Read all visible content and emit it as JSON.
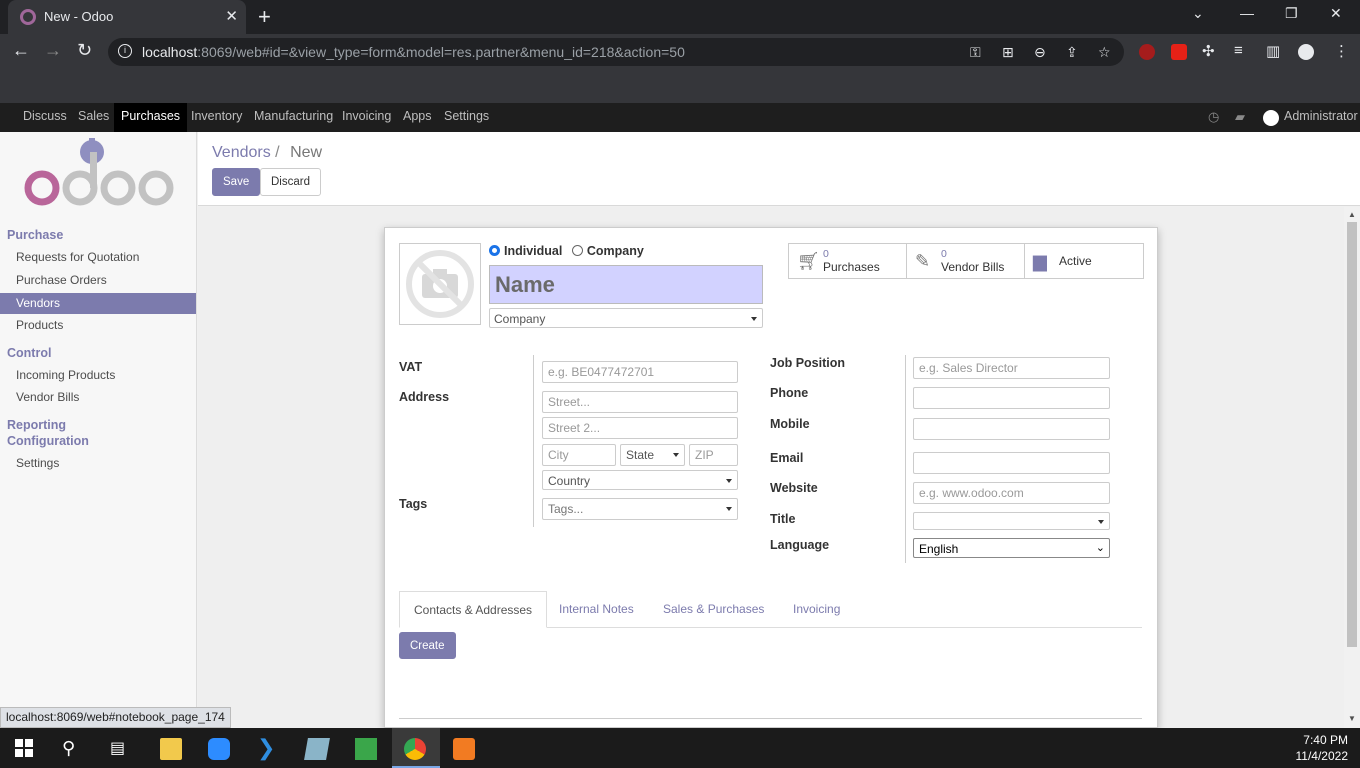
{
  "browser": {
    "tab_title": "New - Odoo",
    "url_host": "localhost",
    "url_rest": ":8069/web#id=&view_type=form&model=res.partner&menu_id=218&action=50",
    "status_url": "localhost:8069/web#notebook_page_174"
  },
  "topmenu": {
    "items": [
      "Discuss",
      "Sales",
      "Purchases",
      "Inventory",
      "Manufacturing",
      "Invoicing",
      "Apps",
      "Settings"
    ],
    "active": "Purchases",
    "user": "Administrator"
  },
  "sidebar": {
    "purchase_head": "Purchase",
    "purchase_items": [
      "Requests for Quotation",
      "Purchase Orders",
      "Vendors",
      "Products"
    ],
    "control_head": "Control",
    "control_items": [
      "Incoming Products",
      "Vendor Bills"
    ],
    "reporting_head": "Reporting",
    "config_head": "Configuration",
    "config_items": [
      "Settings"
    ],
    "active_item": "Vendors"
  },
  "control": {
    "breadcrumb_parent": "Vendors",
    "breadcrumb_sep": "/",
    "breadcrumb_current": "New",
    "save_label": "Save",
    "discard_label": "Discard"
  },
  "form": {
    "type_individual": "Individual",
    "type_company": "Company",
    "name_placeholder": "Name",
    "company_placeholder": "Company",
    "smart": {
      "purchases_count": "0",
      "purchases_label": "Purchases",
      "bills_count": "0",
      "bills_label": "Vendor Bills",
      "active_label": "Active"
    },
    "labels": {
      "vat": "VAT",
      "address": "Address",
      "tags": "Tags",
      "job_position": "Job Position",
      "phone": "Phone",
      "mobile": "Mobile",
      "email": "Email",
      "website": "Website",
      "title": "Title",
      "language": "Language"
    },
    "placeholders": {
      "vat": "e.g. BE0477472701",
      "street": "Street...",
      "street2": "Street 2...",
      "city": "City",
      "state": "State",
      "zip": "ZIP",
      "country": "Country",
      "tags": "Tags...",
      "job_position": "e.g. Sales Director",
      "website": "e.g. www.odoo.com"
    },
    "language_value": "English",
    "tabs": [
      "Contacts & Addresses",
      "Internal Notes",
      "Sales & Purchases",
      "Invoicing"
    ],
    "create_label": "Create"
  },
  "taskbar": {
    "time": "7:40 PM",
    "date": "11/4/2022"
  },
  "colors": {
    "odoo_primary": "#7c7bad",
    "name_field_bg": "#d2d2ff"
  }
}
